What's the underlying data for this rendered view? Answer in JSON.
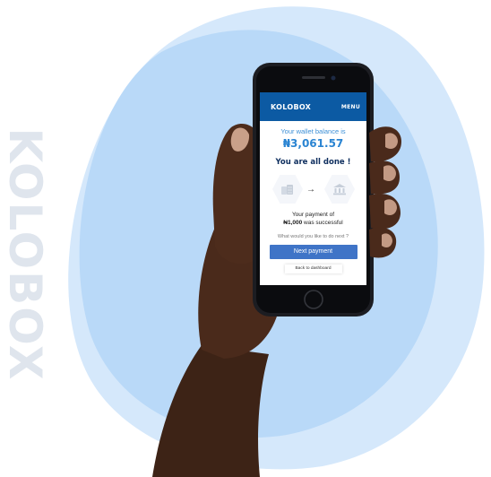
{
  "background": {
    "brand_text": "KOLOBOX",
    "blob_color": "#b8d8f8",
    "blob_back_color": "#d5e8fb"
  },
  "app": {
    "logo": "KOLOBOX",
    "menu_label": "MENU",
    "header_color": "#0c5aa3",
    "balance_label": "Your wallet balance is",
    "balance_amount": "₦3,061.57",
    "done_title": "You are all done !",
    "transfer": {
      "from_icon": "coins-icon",
      "arrow": "→",
      "to_icon": "bank-icon"
    },
    "payment_line1": "Your payment of",
    "payment_amount": "₦1,000",
    "payment_suffix": " was successful",
    "next_question": "What would you like to do next ?",
    "next_button": "Next payment",
    "back_button": "Back to dashboard",
    "button_color": "#3f74c7"
  }
}
